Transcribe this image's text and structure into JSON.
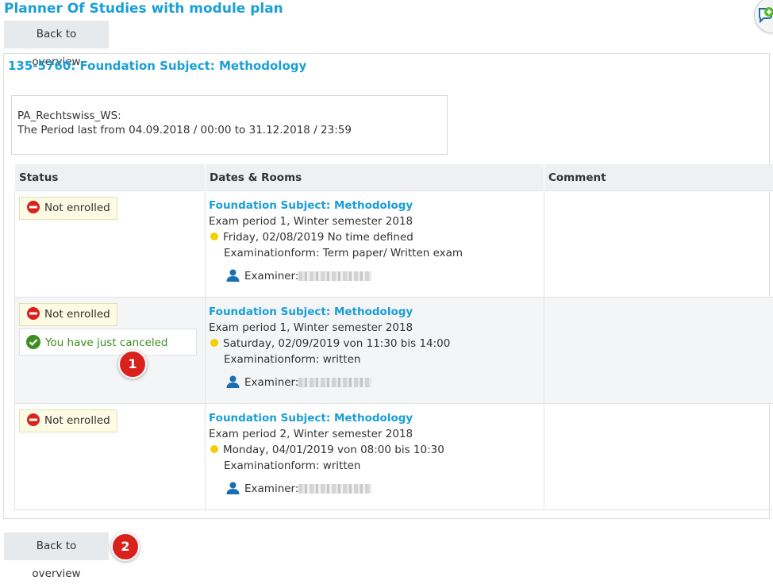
{
  "page": {
    "title": "Planner Of Studies with module plan",
    "back_label": "Back to overview"
  },
  "module": {
    "heading": "135-5760: Foundation Subject: Methodology"
  },
  "period": {
    "name": "PA_Rechtswiss_WS:",
    "text": "The Period last from 04.09.2018 / 00:00 to 31.12.2018 / 23:59"
  },
  "table": {
    "columns": [
      "Status",
      "Dates & Rooms",
      "Comment"
    ],
    "rows": [
      {
        "status": "Not enrolled",
        "title": "Foundation Subject: Methodology",
        "period": "Exam period 1, Winter semester 2018",
        "date": "Friday, 02/08/2019 No time defined",
        "form": "Examinationform: Term paper/ Written exam",
        "examiner_label": "Examiner:",
        "comment": ""
      },
      {
        "status": "Not enrolled",
        "notice": "You have just canceled",
        "title": "Foundation Subject: Methodology",
        "period": "Exam period 1, Winter semester 2018",
        "date": "Saturday, 02/09/2019 von 11:30 bis 14:00",
        "form": "Examinationform: written",
        "examiner_label": "Examiner:",
        "comment": ""
      },
      {
        "status": "Not enrolled",
        "title": "Foundation Subject: Methodology",
        "period": "Exam period 2, Winter semester 2018",
        "date": "Monday, 04/01/2019 von 08:00 bis 10:30",
        "form": "Examinationform: written",
        "examiner_label": "Examiner:",
        "comment": ""
      }
    ]
  },
  "markers": [
    "1",
    "2"
  ],
  "icons": {
    "not_enrolled": "no-entry-icon",
    "canceled": "check-circle-icon",
    "date": "yellow-dot-icon",
    "examiner": "person-icon",
    "corner": "chat-add-icon"
  },
  "colors": {
    "link": "#1a9fd6",
    "not_enrolled": "#d9221c",
    "success": "#3d8f22",
    "date_dot": "#f2cf00",
    "marker": "#d9221c"
  }
}
